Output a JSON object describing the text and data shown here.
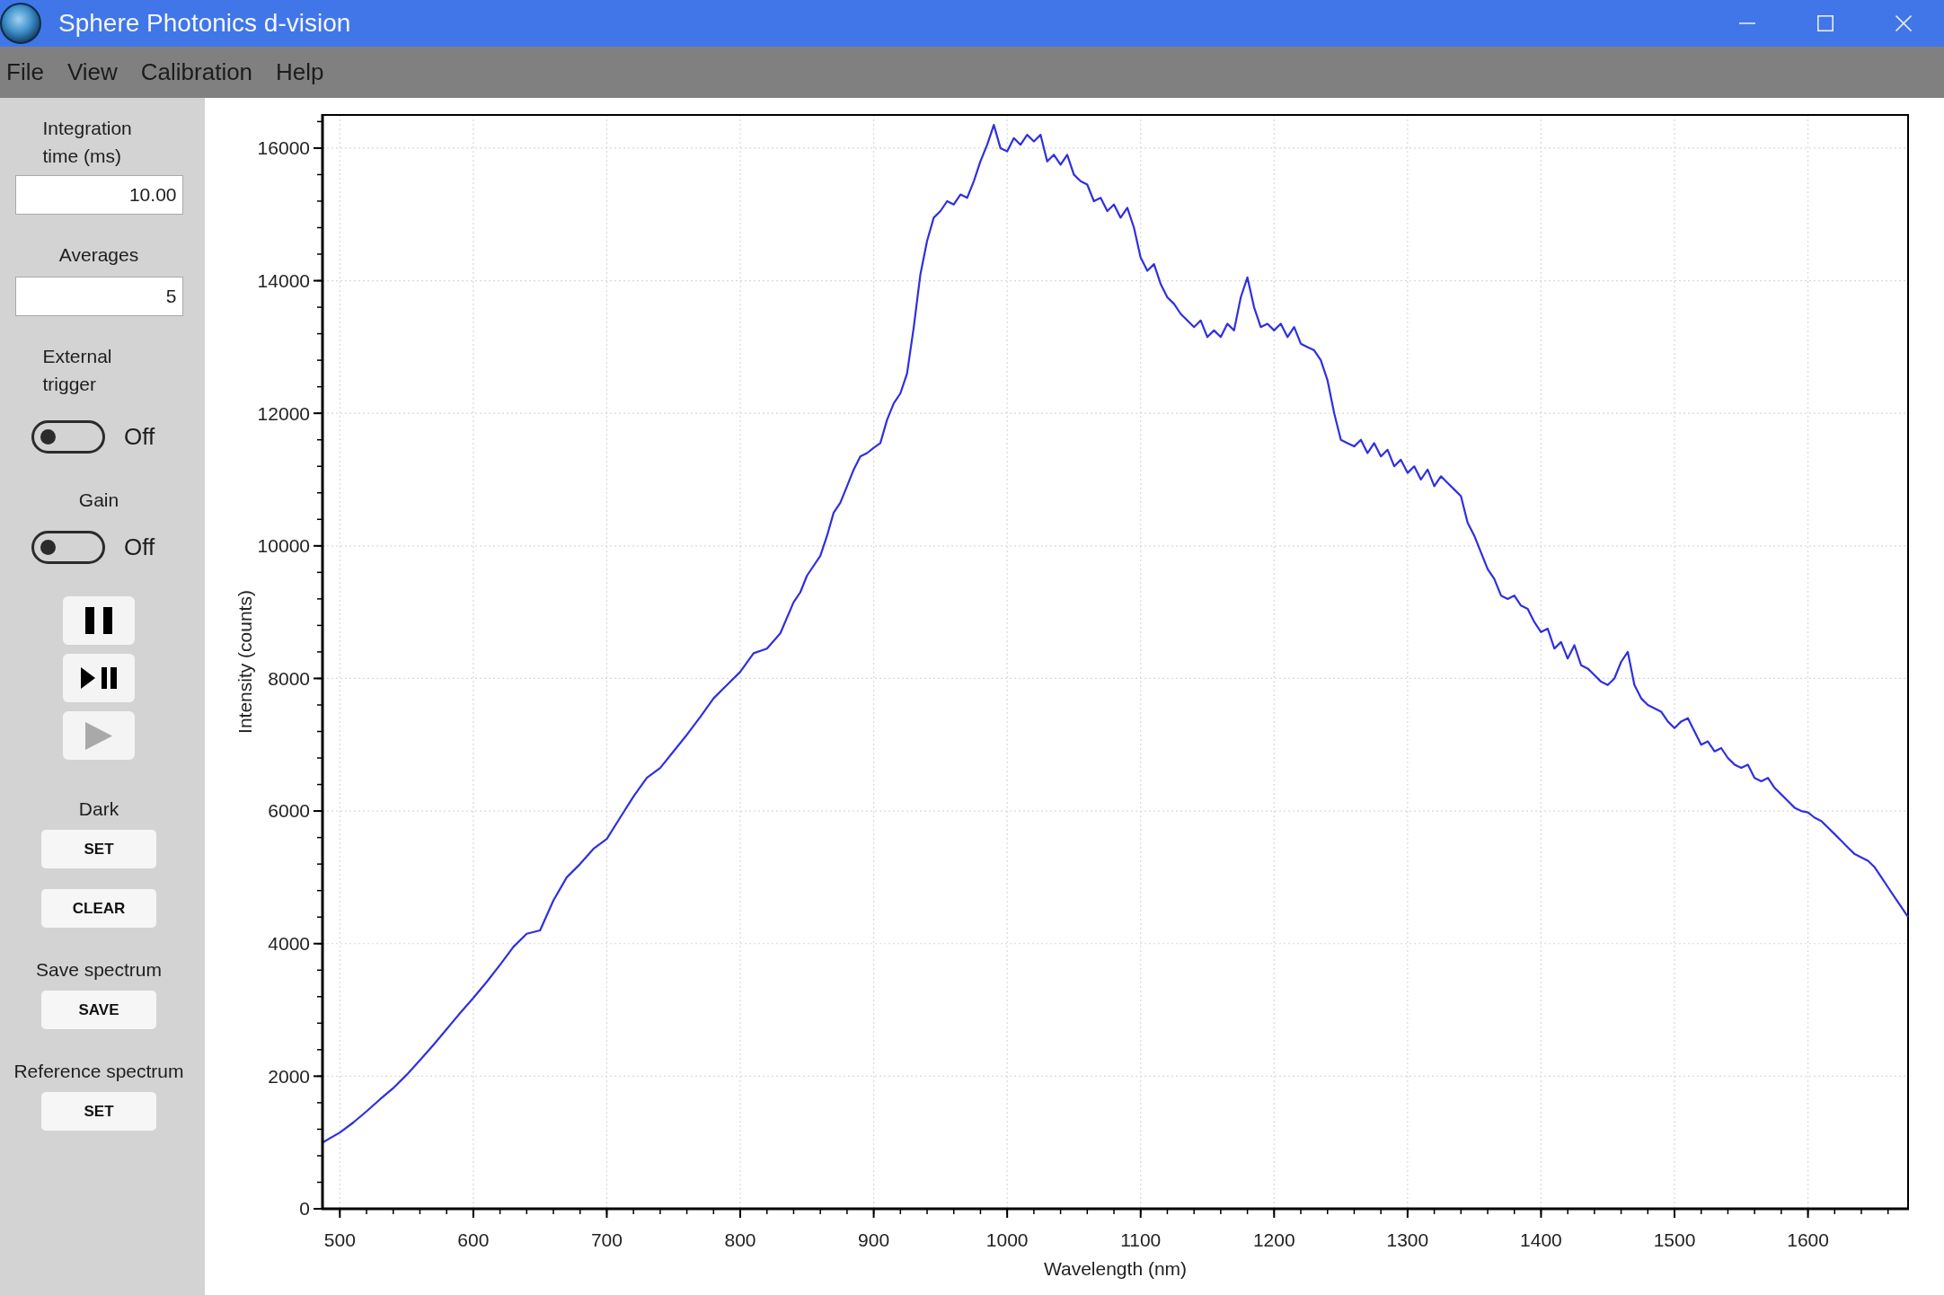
{
  "window": {
    "title": "Sphere Photonics d-vision"
  },
  "menu": [
    "File",
    "View",
    "Calibration",
    "Help"
  ],
  "sidebar": {
    "fields": [
      {
        "label": "Integration time (ms)",
        "value": "10.00"
      },
      {
        "label": "Averages",
        "value": "5"
      }
    ],
    "toggles": [
      {
        "label": "External trigger",
        "on": false,
        "state_text": "Off"
      },
      {
        "label": "Gain",
        "on": false,
        "state_text": "Off"
      }
    ],
    "transport_buttons": [
      {
        "kind": "pause",
        "disabled": false
      },
      {
        "kind": "play-pause",
        "disabled": false
      },
      {
        "kind": "play",
        "disabled": true
      }
    ],
    "sections": [
      {
        "label": "Dark",
        "buttons": [
          "SET",
          "CLEAR"
        ]
      },
      {
        "label": "Save spectrum",
        "buttons": [
          "SAVE"
        ]
      },
      {
        "label": "Reference spectrum",
        "buttons": [
          "SET"
        ]
      }
    ]
  },
  "chart": {
    "chart_data": {
      "type": "line",
      "xlabel": "Wavelength (nm)",
      "ylabel": "Intensity (counts)",
      "grid": true,
      "x": [
        487,
        500,
        510,
        520,
        530,
        540,
        550,
        560,
        570,
        580,
        590,
        600,
        610,
        620,
        630,
        640,
        650,
        660,
        670,
        680,
        690,
        700,
        710,
        720,
        730,
        740,
        750,
        760,
        770,
        780,
        790,
        800,
        810,
        820,
        830,
        840,
        845,
        850,
        855,
        860,
        865,
        870,
        875,
        880,
        885,
        890,
        895,
        900,
        905,
        910,
        915,
        920,
        925,
        930,
        935,
        940,
        945,
        950,
        955,
        960,
        965,
        970,
        975,
        980,
        985,
        990,
        995,
        1000,
        1005,
        1010,
        1015,
        1020,
        1025,
        1030,
        1035,
        1040,
        1045,
        1050,
        1055,
        1060,
        1065,
        1070,
        1075,
        1080,
        1085,
        1090,
        1095,
        1100,
        1105,
        1110,
        1115,
        1120,
        1125,
        1130,
        1135,
        1140,
        1145,
        1150,
        1155,
        1160,
        1165,
        1170,
        1175,
        1180,
        1185,
        1190,
        1195,
        1200,
        1205,
        1210,
        1215,
        1220,
        1225,
        1230,
        1235,
        1240,
        1245,
        1250,
        1255,
        1260,
        1265,
        1270,
        1275,
        1280,
        1285,
        1290,
        1295,
        1300,
        1305,
        1310,
        1315,
        1320,
        1325,
        1330,
        1335,
        1340,
        1345,
        1350,
        1355,
        1360,
        1365,
        1370,
        1375,
        1380,
        1385,
        1390,
        1395,
        1400,
        1405,
        1410,
        1415,
        1420,
        1425,
        1430,
        1435,
        1440,
        1445,
        1450,
        1455,
        1460,
        1465,
        1470,
        1475,
        1480,
        1485,
        1490,
        1495,
        1500,
        1505,
        1510,
        1515,
        1520,
        1525,
        1530,
        1535,
        1540,
        1545,
        1550,
        1555,
        1560,
        1565,
        1570,
        1575,
        1580,
        1585,
        1590,
        1595,
        1600,
        1605,
        1610,
        1615,
        1620,
        1625,
        1630,
        1635,
        1640,
        1645,
        1650,
        1655,
        1660,
        1665,
        1670,
        1675
      ],
      "series": [
        {
          "color": "#2f2fe0",
          "values": [
            1000,
            1150,
            1300,
            1470,
            1650,
            1820,
            2020,
            2240,
            2470,
            2710,
            2950,
            3180,
            3420,
            3680,
            3950,
            4150,
            4200,
            4650,
            5000,
            5200,
            5430,
            5580,
            5900,
            6220,
            6500,
            6650,
            6900,
            7150,
            7420,
            7700,
            7900,
            8100,
            8380,
            8450,
            8680,
            9150,
            9300,
            9550,
            9700,
            9850,
            10150,
            10500,
            10650,
            10900,
            11150,
            11350,
            11400,
            11480,
            11550,
            11900,
            12150,
            12300,
            12600,
            13300,
            14100,
            14600,
            14950,
            15050,
            15200,
            15150,
            15300,
            15250,
            15500,
            15800,
            16050,
            16350,
            16000,
            15950,
            16150,
            16050,
            16200,
            16100,
            16200,
            15800,
            15900,
            15750,
            15900,
            15600,
            15500,
            15450,
            15200,
            15250,
            15050,
            15150,
            14950,
            15100,
            14800,
            14350,
            14150,
            14250,
            13950,
            13750,
            13650,
            13500,
            13400,
            13300,
            13400,
            13150,
            13250,
            13150,
            13350,
            13250,
            13750,
            14050,
            13600,
            13300,
            13350,
            13250,
            13350,
            13150,
            13300,
            13050,
            13000,
            12950,
            12800,
            12500,
            12000,
            11600,
            11550,
            11500,
            11600,
            11400,
            11550,
            11350,
            11450,
            11200,
            11300,
            11100,
            11200,
            11000,
            11150,
            10900,
            11050,
            10950,
            10850,
            10750,
            10350,
            10150,
            9900,
            9650,
            9500,
            9250,
            9200,
            9250,
            9100,
            9050,
            8850,
            8700,
            8750,
            8450,
            8550,
            8300,
            8500,
            8200,
            8150,
            8050,
            7950,
            7900,
            8000,
            8250,
            8400,
            7900,
            7700,
            7600,
            7550,
            7500,
            7350,
            7250,
            7350,
            7400,
            7200,
            7000,
            7050,
            6900,
            6950,
            6800,
            6700,
            6650,
            6700,
            6500,
            6450,
            6500,
            6350,
            6250,
            6150,
            6050,
            6000,
            5980,
            5900,
            5850,
            5750,
            5650,
            5550,
            5450,
            5350,
            5300,
            5250,
            5150,
            5000,
            4850,
            4700,
            4550,
            4400
          ]
        }
      ],
      "xlim": [
        487,
        1675
      ],
      "ylim": [
        0,
        16500
      ],
      "xticks": [
        500,
        600,
        700,
        800,
        900,
        1000,
        1100,
        1200,
        1300,
        1400,
        1500,
        1600
      ],
      "yticks": [
        0,
        2000,
        4000,
        6000,
        8000,
        10000,
        12000,
        14000,
        16000
      ]
    }
  }
}
